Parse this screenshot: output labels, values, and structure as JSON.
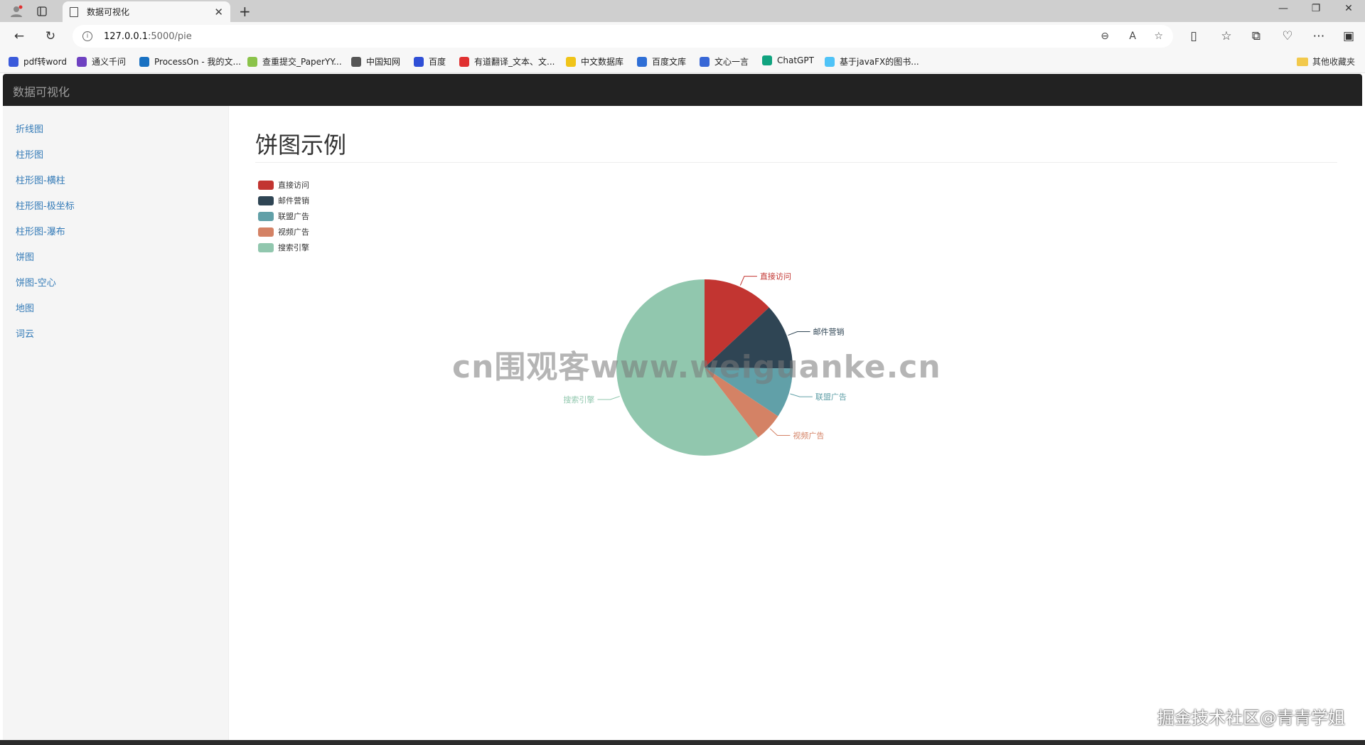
{
  "browser": {
    "tab_title": "数据可视化",
    "url_host": "127.0.0.1",
    "url_path": ":5000/pie",
    "bookmarks": [
      {
        "label": "pdf转word",
        "color": "#3b5bdb"
      },
      {
        "label": "通义千问",
        "color": "#6f42c1"
      },
      {
        "label": "ProcessOn - 我的文...",
        "color": "#1971c2"
      },
      {
        "label": "查重提交_PaperYY...",
        "color": "#8bc34a"
      },
      {
        "label": "中国知网",
        "color": "#555555"
      },
      {
        "label": "百度",
        "color": "#2f4fd6"
      },
      {
        "label": "有道翻译_文本、文...",
        "color": "#e03131"
      },
      {
        "label": "中文数据库",
        "color": "#f0c419"
      },
      {
        "label": "百度文库",
        "color": "#2f6fd6"
      },
      {
        "label": "文心一言",
        "color": "#3867d6"
      },
      {
        "label": "ChatGPT",
        "color": "#10a37f"
      },
      {
        "label": "基于javaFX的图书...",
        "color": "#4fc3f7"
      }
    ],
    "other_bookmarks": "其他收藏夹"
  },
  "app": {
    "brand": "数据可视化",
    "sidebar": {
      "items": [
        {
          "label": "折线图"
        },
        {
          "label": "柱形图"
        },
        {
          "label": "柱形图-横柱"
        },
        {
          "label": "柱形图-极坐标"
        },
        {
          "label": "柱形图-瀑布"
        },
        {
          "label": "饼图"
        },
        {
          "label": "饼图-空心"
        },
        {
          "label": "地图"
        },
        {
          "label": "词云"
        }
      ]
    },
    "page_title": "饼图示例"
  },
  "chart_data": {
    "type": "pie",
    "title": "",
    "legend_position": "top-left",
    "categories": [
      "直接访问",
      "邮件营销",
      "联盟广告",
      "视频广告",
      "搜索引擎"
    ],
    "values": [
      335,
      310,
      234,
      135,
      1548
    ],
    "colors": [
      "#c23531",
      "#2f4554",
      "#61a0a8",
      "#d48265",
      "#91c7ae"
    ]
  },
  "overlay": {
    "watermark": "cn围观客www.weiguanke.cn",
    "corner_mark": "掘金技术社区@青青学姐"
  }
}
